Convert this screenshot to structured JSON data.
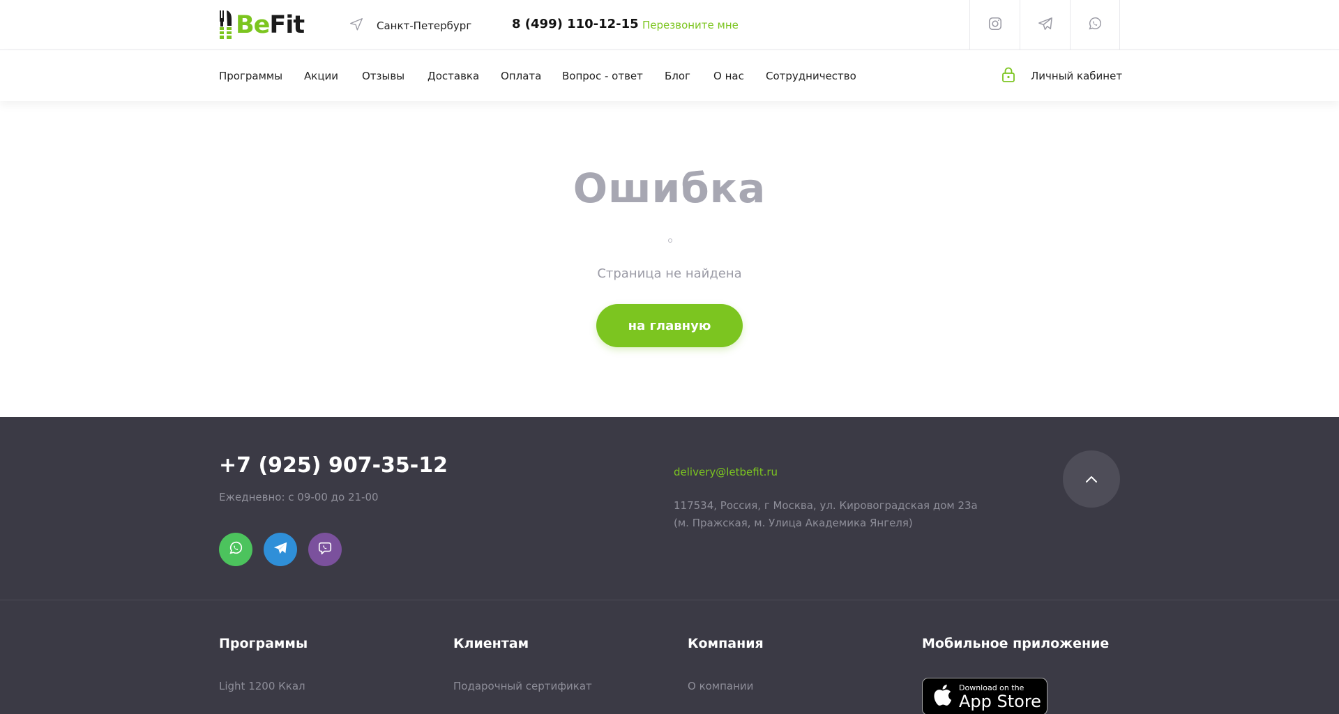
{
  "brand": {
    "name_part1": "Be",
    "name_part2": "Fit",
    "accent": "#7cc520"
  },
  "header": {
    "city": "Санкт-Петербург",
    "phone": "8 (499) 110-12-15",
    "callback": "Перезвоните мне",
    "socials": [
      "instagram-icon",
      "telegram-icon",
      "whatsapp-icon"
    ]
  },
  "nav": {
    "items": [
      "Программы",
      "Акции",
      "Отзывы",
      "Доставка",
      "Оплата",
      "Вопрос - ответ",
      "Блог",
      "О нас",
      "Сотрудничество"
    ],
    "cabinet": "Личный кабинет"
  },
  "error": {
    "title": "Ошибка",
    "subtitle": "Страница не найдена",
    "button": "на главную"
  },
  "footer": {
    "phone": "+7 (925) 907-35-12",
    "hours": "Ежедневно: с 09-00 до 21-00",
    "email": "delivery@letbefit.ru",
    "address_line1": "117534, Россия, г Москва, ул. Кировоградская дом 23а",
    "address_line2": "(м. Пражская, м. Улица Академика Янгеля)",
    "messengers": [
      {
        "icon": "whatsapp-icon",
        "color": "#4cc35d"
      },
      {
        "icon": "telegram-icon",
        "color": "#2f8fd8"
      },
      {
        "icon": "viber-icon",
        "color": "#7b519d"
      }
    ],
    "columns": [
      {
        "title": "Программы",
        "first_link": "Light 1200 Ккал"
      },
      {
        "title": "Клиентам",
        "first_link": "Подарочный сертификат"
      },
      {
        "title": "Компания",
        "first_link": "О компании"
      },
      {
        "title": "Мобильное приложение"
      }
    ],
    "appstore": {
      "small": "Download on the",
      "big": "App Store"
    },
    "background": "#3b3a45"
  }
}
